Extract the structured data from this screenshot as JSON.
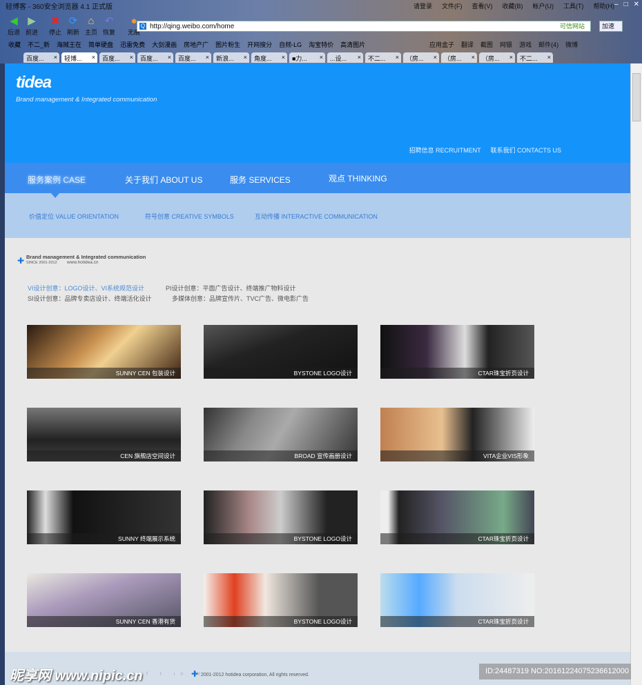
{
  "browser": {
    "title": "轻博客 - 360安全浏览器 4.1 正式版",
    "menu": [
      "请登录",
      "文件(F)",
      "查看(V)",
      "收藏(B)",
      "帐户(U)",
      "工具(T)",
      "帮助(H)"
    ],
    "nav_buttons": [
      {
        "icon": "back-arrow",
        "label": "后退"
      },
      {
        "icon": "forward-arrow",
        "label": "前进"
      },
      {
        "icon": "stop-x",
        "label": "停止"
      },
      {
        "icon": "refresh",
        "label": "刷新"
      },
      {
        "icon": "home",
        "label": "主页"
      },
      {
        "icon": "undo",
        "label": "恢复"
      },
      {
        "icon": "paw",
        "label": "无痕"
      }
    ],
    "url": "http://qing.weibo.com/home",
    "trust": "可信网站",
    "speed": "加速",
    "bookmarks": [
      "收藏",
      "不二_新",
      "海贼王在",
      "简单硬盘",
      "迅雷免费",
      "大剑漫画",
      "房地产广",
      "图片粉生",
      "开网搜分",
      "自频-LG",
      "淘宝特价",
      "高清图片"
    ],
    "bookmarks_right": [
      "应用盒子",
      "翻译",
      "截图",
      "网银",
      "游戏",
      "邮件(4)",
      "微博"
    ],
    "tabs": [
      "百度...",
      "轻博...",
      "百度...",
      "百度...",
      "百度...",
      "新浪...",
      "角度...",
      "■力...",
      "...设...",
      "不二...",
      "（房...",
      "（房...",
      "（房...",
      "不二..."
    ],
    "active_tab": 1
  },
  "site": {
    "logo": "tidea",
    "slogan": "Brand management & Integrated communication",
    "top_links": [
      "招聘信息  RECRUITMENT",
      "联系我们  CONTACTS US"
    ],
    "nav": [
      "服务案例  CASE",
      "关于我们  ABOUT US",
      "服务  SERVICES",
      "观点   THINKING"
    ],
    "subnav": [
      "价值定位  VALUE ORIENTATION",
      "符号创意  CREATIVE SYMBOLS",
      "互动传播  INTERACTIVE COMMUNICATION"
    ],
    "brand": {
      "title": "Brand management & Integrated communication",
      "since": "SINCE 2001-2012",
      "url": "www.hotidea.cn"
    },
    "services": [
      "VI设计创意：LOGO设计、VI系统规范设计",
      "PI设计创意：平面广告设计、终端推广物料设计",
      "SI设计创意：品牌专卖店设计、终端活化设计",
      "多媒体创意：品牌宣传片、TVC广告、微电影广告"
    ],
    "cases": [
      "SUNNY CEN 包装设计",
      "BYSTONE LOGO设计",
      "CTAR珠宝折页设计",
      "CEN 旗舰店空间设计",
      "BROAD 宣传画册设计",
      "VITA企业VIS形象",
      "SUNNY 终端展示系统",
      "BYSTONE LOGO设计",
      "CTAR珠宝折页设计",
      "SUNNY CEN 香港有货",
      "BYSTONE LOGO设计",
      "CTAR珠宝折页设计"
    ],
    "footer": {
      "social": "f t in W",
      "copyright": "2001-2012 hotidea corporation, All rights reserved."
    },
    "colors": {
      "header": "#1493fb",
      "nav": "#3a8cee",
      "subnav": "#b0cdee",
      "body": "#e8e8e8",
      "footer": "#d5dfea"
    }
  },
  "watermark": {
    "logo": "昵享网 www.nipic.cn",
    "id": "ID:24487319 NO:20161224075236612000"
  }
}
